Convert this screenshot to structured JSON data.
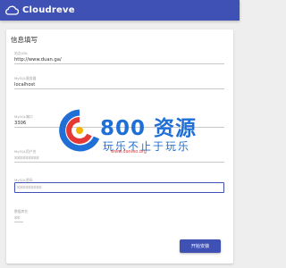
{
  "appbar": {
    "brand": "Cloudreve"
  },
  "card": {
    "title": "信息填写"
  },
  "fields": [
    {
      "label": "站点URL",
      "value": "http://www.duan.ga/"
    },
    {
      "label": "MySQL服务器",
      "value": "localhost"
    },
    {
      "label": "MySQL端口",
      "value": "3306"
    },
    {
      "label": "MySQL用户名",
      "value": "xxxxxxxxx"
    },
    {
      "label": "MySQL密码",
      "value": "xxxxxxxxx"
    },
    {
      "label": "数据库名",
      "value": "xx"
    }
  ],
  "actions": {
    "submit_label": "开始安装"
  },
  "watermark": {
    "big": "800 资源",
    "slogan": "玩乐不止于玩乐",
    "url": "www.danleo.org"
  },
  "colors": {
    "primary": "#3f51b5",
    "watermark_blue": "#1f6fd6",
    "watermark_red": "#e53935"
  }
}
